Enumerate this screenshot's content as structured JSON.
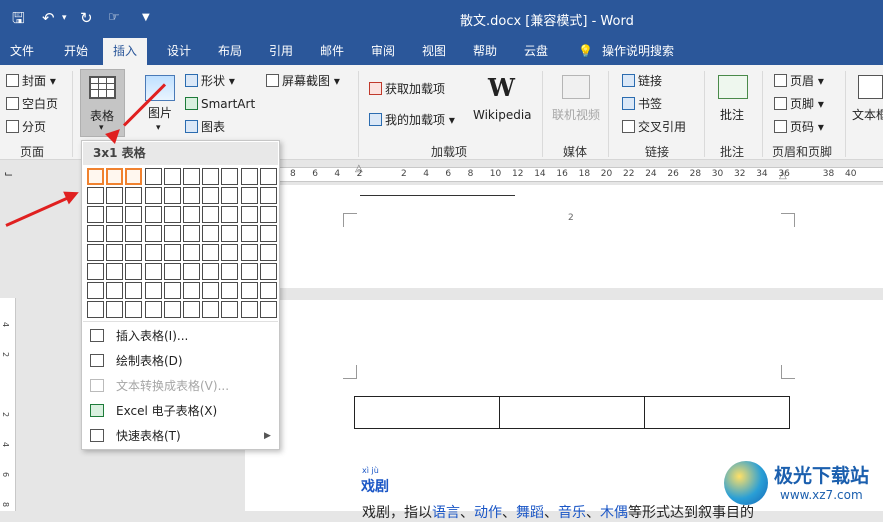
{
  "titlebar": {
    "title": "散文.docx [兼容模式] - Word",
    "quick_access": [
      "save-icon",
      "undo-icon",
      "redo-icon",
      "touch-mode-icon",
      "customize-icon"
    ]
  },
  "tabs": [
    "文件",
    "开始",
    "插入",
    "设计",
    "布局",
    "引用",
    "邮件",
    "审阅",
    "视图",
    "帮助",
    "云盘",
    "操作说明搜索"
  ],
  "active_tab": "插入",
  "ribbon": {
    "pages": {
      "cover": "封面",
      "blank": "空白页",
      "break": "分页",
      "group": "页面"
    },
    "table_button": "表格",
    "illustrations": {
      "picture": "图片",
      "shapes": "形状",
      "smartart": "SmartArt",
      "chart": "图表",
      "screenshot": "屏幕截图"
    },
    "addins": {
      "get": "获取加载项",
      "mine": "我的加载项",
      "wikipedia": "Wikipedia",
      "group": "加载项"
    },
    "media": {
      "online_video": "联机视频",
      "group": "媒体"
    },
    "links": {
      "link": "链接",
      "bookmark": "书签",
      "crossref": "交叉引用",
      "group": "链接"
    },
    "comments": {
      "comment": "批注",
      "group": "批注"
    },
    "header_footer": {
      "header": "页眉",
      "footer": "页脚",
      "page_number": "页码",
      "group": "页眉和页脚"
    },
    "text": {
      "textbox": "文本框"
    }
  },
  "ruler": {
    "ticks": [
      "8",
      "6",
      "4",
      "2",
      "",
      "2",
      "4",
      "6",
      "8",
      "10",
      "12",
      "14",
      "16",
      "18",
      "20",
      "22",
      "24",
      "26",
      "28",
      "30",
      "32",
      "34",
      "36",
      "",
      "38",
      "40"
    ]
  },
  "vertical_ruler": {
    "ticks": [
      "4",
      "2",
      "",
      "2",
      "4",
      "6",
      "8"
    ]
  },
  "table_menu": {
    "header": "3x1 表格",
    "grid": {
      "rows": 8,
      "cols": 10,
      "selected_rows": 1,
      "selected_cols": 3
    },
    "items": [
      {
        "label": "插入表格(I)...",
        "disabled": false,
        "has_submenu": false
      },
      {
        "label": "绘制表格(D)",
        "disabled": false,
        "has_submenu": false
      },
      {
        "label": "文本转换成表格(V)...",
        "disabled": true,
        "has_submenu": false
      },
      {
        "label": "Excel 电子表格(X)",
        "disabled": false,
        "has_submenu": false
      },
      {
        "label": "快速表格(T)",
        "disabled": false,
        "has_submenu": true
      }
    ]
  },
  "document": {
    "page_number": "2",
    "preview_table": {
      "rows": 1,
      "cols": 3
    },
    "pinyin": "xì jù",
    "heading": "戏剧",
    "body_segments": [
      "戏剧，指以",
      "语言",
      "、",
      "动作",
      "、",
      "舞蹈",
      "、",
      "音乐",
      "、",
      "木偶",
      "等形式达到叙事目的"
    ]
  },
  "watermark": {
    "brand": "极光下载站",
    "url": "www.xz7.com"
  },
  "colors": {
    "brand": "#2b579a",
    "arrow": "#e02020",
    "highlight": "#f0822f",
    "link": "#1a56c6"
  }
}
